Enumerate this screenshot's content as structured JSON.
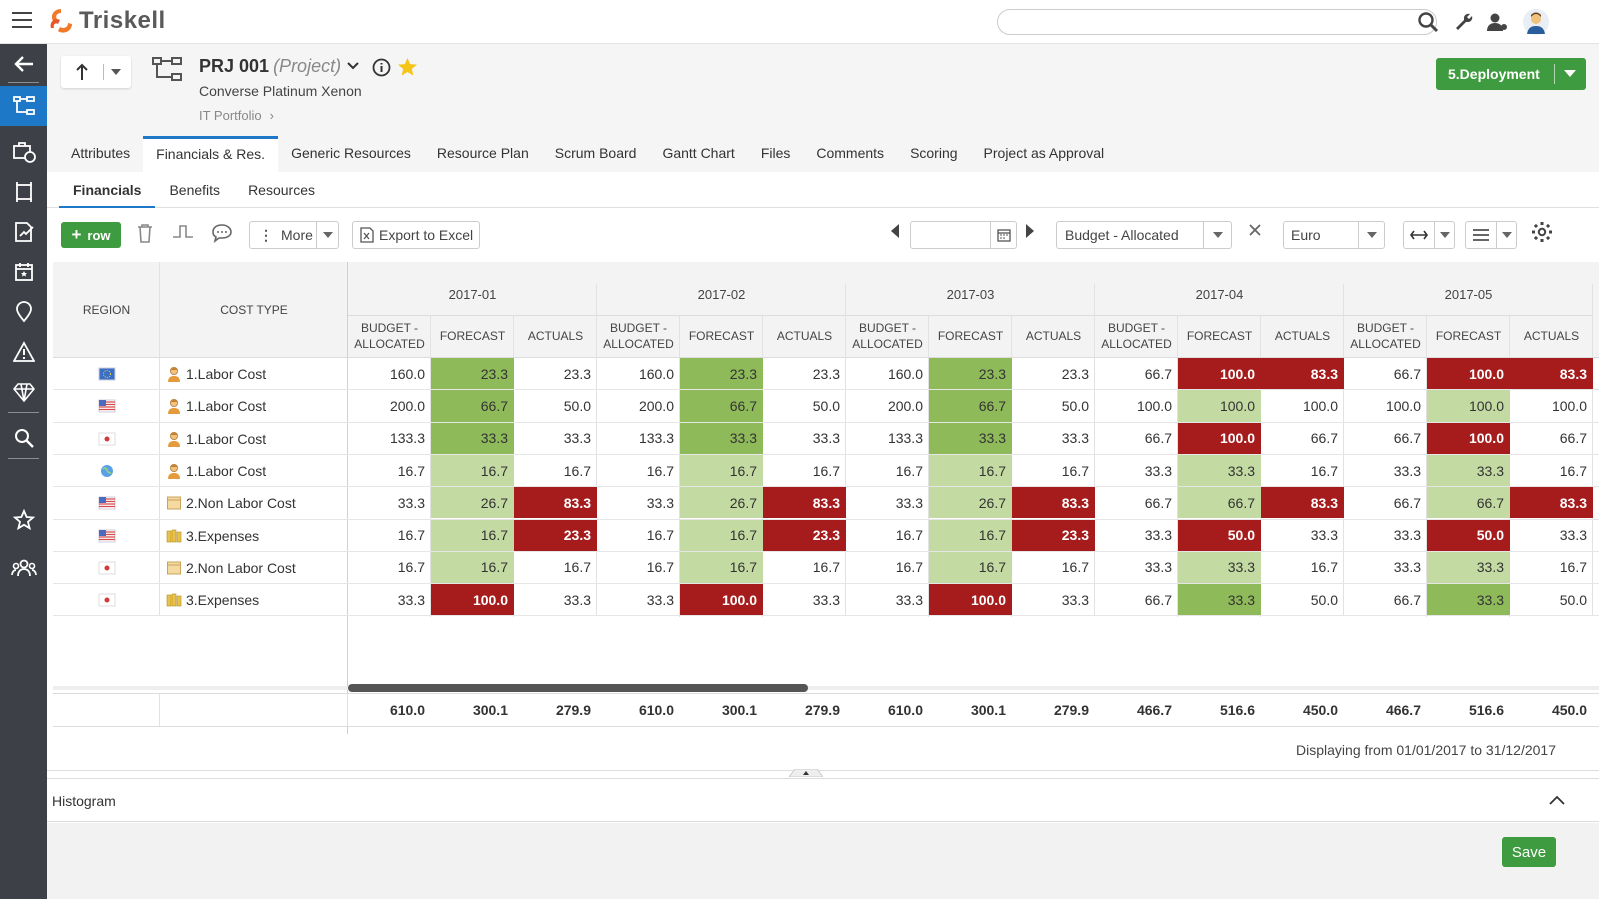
{
  "app": {
    "name": "Triskell"
  },
  "project": {
    "code": "PRJ 001",
    "kind": "(Project)",
    "name": "Converse Platinum Xenon",
    "breadcrumb": "IT Portfolio",
    "stage": "5.Deployment"
  },
  "tabs": [
    "Attributes",
    "Financials & Res.",
    "Generic Resources",
    "Resource Plan",
    "Scrum Board",
    "Gantt Chart",
    "Files",
    "Comments",
    "Scoring",
    "Project as Approval"
  ],
  "active_tab": "Financials & Res.",
  "subtabs": [
    "Financials",
    "Benefits",
    "Resources"
  ],
  "toolbar": {
    "add_row": "row",
    "more": "More",
    "export": "Export to Excel",
    "date_value": "",
    "measure": "Budget - Allocated",
    "currency": "Euro"
  },
  "grid": {
    "col_region": "REGION",
    "col_cost_type": "COST TYPE",
    "sub_headers": [
      "BUDGET - ALLOCATED",
      "FORECAST",
      "ACTUALS"
    ],
    "periods": [
      "2017-01",
      "2017-02",
      "2017-03",
      "2017-04",
      "2017-05"
    ],
    "rows": [
      {
        "region": "EU",
        "cost_type": "1.Labor Cost",
        "icon": "person-icon",
        "values": [
          [
            "160.0",
            "23.3",
            "23.3"
          ],
          [
            "160.0",
            "23.3",
            "23.3"
          ],
          [
            "160.0",
            "23.3",
            "23.3"
          ],
          [
            "66.7",
            "100.0",
            "83.3"
          ],
          [
            "66.7",
            "100.0",
            "83.3"
          ]
        ],
        "states": [
          [
            "",
            "g",
            ""
          ],
          [
            "",
            "g",
            ""
          ],
          [
            "",
            "g",
            ""
          ],
          [
            "",
            "r",
            "r"
          ],
          [
            "",
            "r",
            "r"
          ]
        ]
      },
      {
        "region": "US",
        "cost_type": "1.Labor Cost",
        "icon": "person-icon",
        "values": [
          [
            "200.0",
            "66.7",
            "50.0"
          ],
          [
            "200.0",
            "66.7",
            "50.0"
          ],
          [
            "200.0",
            "66.7",
            "50.0"
          ],
          [
            "100.0",
            "100.0",
            "100.0"
          ],
          [
            "100.0",
            "100.0",
            "100.0"
          ]
        ],
        "states": [
          [
            "",
            "g",
            ""
          ],
          [
            "",
            "g",
            ""
          ],
          [
            "",
            "g",
            ""
          ],
          [
            "",
            "lg",
            ""
          ],
          [
            "",
            "lg",
            ""
          ]
        ]
      },
      {
        "region": "JP",
        "cost_type": "1.Labor Cost",
        "icon": "person-icon",
        "values": [
          [
            "133.3",
            "33.3",
            "33.3"
          ],
          [
            "133.3",
            "33.3",
            "33.3"
          ],
          [
            "133.3",
            "33.3",
            "33.3"
          ],
          [
            "66.7",
            "100.0",
            "66.7"
          ],
          [
            "66.7",
            "100.0",
            "66.7"
          ]
        ],
        "states": [
          [
            "",
            "g",
            ""
          ],
          [
            "",
            "g",
            ""
          ],
          [
            "",
            "g",
            ""
          ],
          [
            "",
            "r",
            ""
          ],
          [
            "",
            "r",
            ""
          ]
        ]
      },
      {
        "region": "Global",
        "cost_type": "1.Labor Cost",
        "icon": "person-icon",
        "values": [
          [
            "16.7",
            "16.7",
            "16.7"
          ],
          [
            "16.7",
            "16.7",
            "16.7"
          ],
          [
            "16.7",
            "16.7",
            "16.7"
          ],
          [
            "33.3",
            "33.3",
            "16.7"
          ],
          [
            "33.3",
            "33.3",
            "16.7"
          ]
        ],
        "states": [
          [
            "",
            "lg",
            ""
          ],
          [
            "",
            "lg",
            ""
          ],
          [
            "",
            "lg",
            ""
          ],
          [
            "",
            "lg",
            ""
          ],
          [
            "",
            "lg",
            ""
          ]
        ]
      },
      {
        "region": "US",
        "cost_type": "2.Non Labor Cost",
        "icon": "box-icon",
        "values": [
          [
            "33.3",
            "26.7",
            "83.3"
          ],
          [
            "33.3",
            "26.7",
            "83.3"
          ],
          [
            "33.3",
            "26.7",
            "83.3"
          ],
          [
            "66.7",
            "66.7",
            "83.3"
          ],
          [
            "66.7",
            "66.7",
            "83.3"
          ]
        ],
        "states": [
          [
            "",
            "lg",
            "r"
          ],
          [
            "",
            "lg",
            "r"
          ],
          [
            "",
            "lg",
            "r"
          ],
          [
            "",
            "lg",
            "r"
          ],
          [
            "",
            "lg",
            "r"
          ]
        ]
      },
      {
        "region": "US",
        "cost_type": "3.Expenses",
        "icon": "money-icon",
        "values": [
          [
            "16.7",
            "16.7",
            "23.3"
          ],
          [
            "16.7",
            "16.7",
            "23.3"
          ],
          [
            "16.7",
            "16.7",
            "23.3"
          ],
          [
            "33.3",
            "50.0",
            "33.3"
          ],
          [
            "33.3",
            "50.0",
            "33.3"
          ]
        ],
        "states": [
          [
            "",
            "lg",
            "r"
          ],
          [
            "",
            "lg",
            "r"
          ],
          [
            "",
            "lg",
            "r"
          ],
          [
            "",
            "r",
            ""
          ],
          [
            "",
            "r",
            ""
          ]
        ]
      },
      {
        "region": "JP",
        "cost_type": "2.Non Labor Cost",
        "icon": "box-icon",
        "values": [
          [
            "16.7",
            "16.7",
            "16.7"
          ],
          [
            "16.7",
            "16.7",
            "16.7"
          ],
          [
            "16.7",
            "16.7",
            "16.7"
          ],
          [
            "33.3",
            "33.3",
            "16.7"
          ],
          [
            "33.3",
            "33.3",
            "16.7"
          ]
        ],
        "states": [
          [
            "",
            "lg",
            ""
          ],
          [
            "",
            "lg",
            ""
          ],
          [
            "",
            "lg",
            ""
          ],
          [
            "",
            "lg",
            ""
          ],
          [
            "",
            "lg",
            ""
          ]
        ]
      },
      {
        "region": "JP",
        "cost_type": "3.Expenses",
        "icon": "money-icon",
        "values": [
          [
            "33.3",
            "100.0",
            "33.3"
          ],
          [
            "33.3",
            "100.0",
            "33.3"
          ],
          [
            "33.3",
            "100.0",
            "33.3"
          ],
          [
            "66.7",
            "33.3",
            "50.0"
          ],
          [
            "66.7",
            "33.3",
            "50.0"
          ]
        ],
        "states": [
          [
            "",
            "r",
            ""
          ],
          [
            "",
            "r",
            ""
          ],
          [
            "",
            "r",
            ""
          ],
          [
            "",
            "g",
            ""
          ],
          [
            "",
            "g",
            ""
          ]
        ]
      }
    ],
    "totals": [
      [
        "610.0",
        "300.1",
        "279.9"
      ],
      [
        "610.0",
        "300.1",
        "279.9"
      ],
      [
        "610.0",
        "300.1",
        "279.9"
      ],
      [
        "466.7",
        "516.6",
        "450.0"
      ],
      [
        "466.7",
        "516.6",
        "450.0"
      ]
    ]
  },
  "display_range": "Displaying from 01/01/2017 to 31/12/2017",
  "histogram_label": "Histogram",
  "save_label": "Save",
  "colors": {
    "green": "#8fba5a",
    "light_green": "#c3dba2",
    "red": "#a61c1c",
    "accent": "#1e78c8",
    "brand_orange": "#f07a2a",
    "nav_bg": "#3d4147"
  }
}
